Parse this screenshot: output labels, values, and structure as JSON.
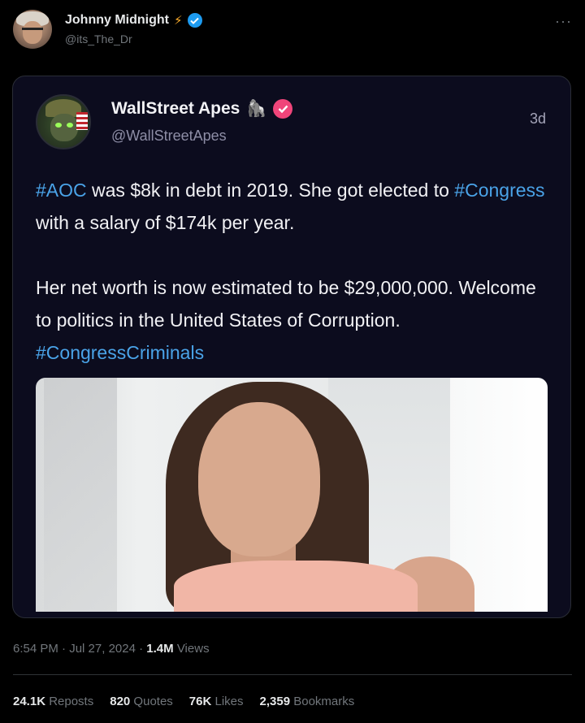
{
  "post": {
    "author_name": "Johnny Midnight",
    "author_handle": "@its_The_Dr",
    "name_emoji": "⚡",
    "more": "···"
  },
  "quote": {
    "author_name": "WallStreet Apes",
    "name_emoji": "🦍",
    "author_handle": "@WallStreetApes",
    "time": "3d",
    "para1": {
      "tag1": "#AOC",
      "t1": " was $8k in debt in 2019. She got elected to ",
      "tag2": "#Congress",
      "t2": " with a salary of $174k per year."
    },
    "para2": {
      "t1": "Her net worth is now estimated to be $29,000,000. Welcome to politics in the United States of Corruption. ",
      "tag1": "#CongressCriminals"
    }
  },
  "meta": {
    "time": "6:54 PM",
    "sep1": " · ",
    "date": "Jul 27, 2024",
    "sep2": " · ",
    "views_count": "1.4M",
    "views_label": " Views"
  },
  "stats": [
    {
      "count": "24.1K",
      "label": " Reposts"
    },
    {
      "count": "820",
      "label": " Quotes"
    },
    {
      "count": "76K",
      "label": " Likes"
    },
    {
      "count": "2,359",
      "label": " Bookmarks"
    }
  ],
  "colors": {
    "hashtag": "#4aa3e8",
    "verified_blue": "#1d9bf0",
    "verified_pink": "#f0457a",
    "bolt": "#ffae2b"
  }
}
